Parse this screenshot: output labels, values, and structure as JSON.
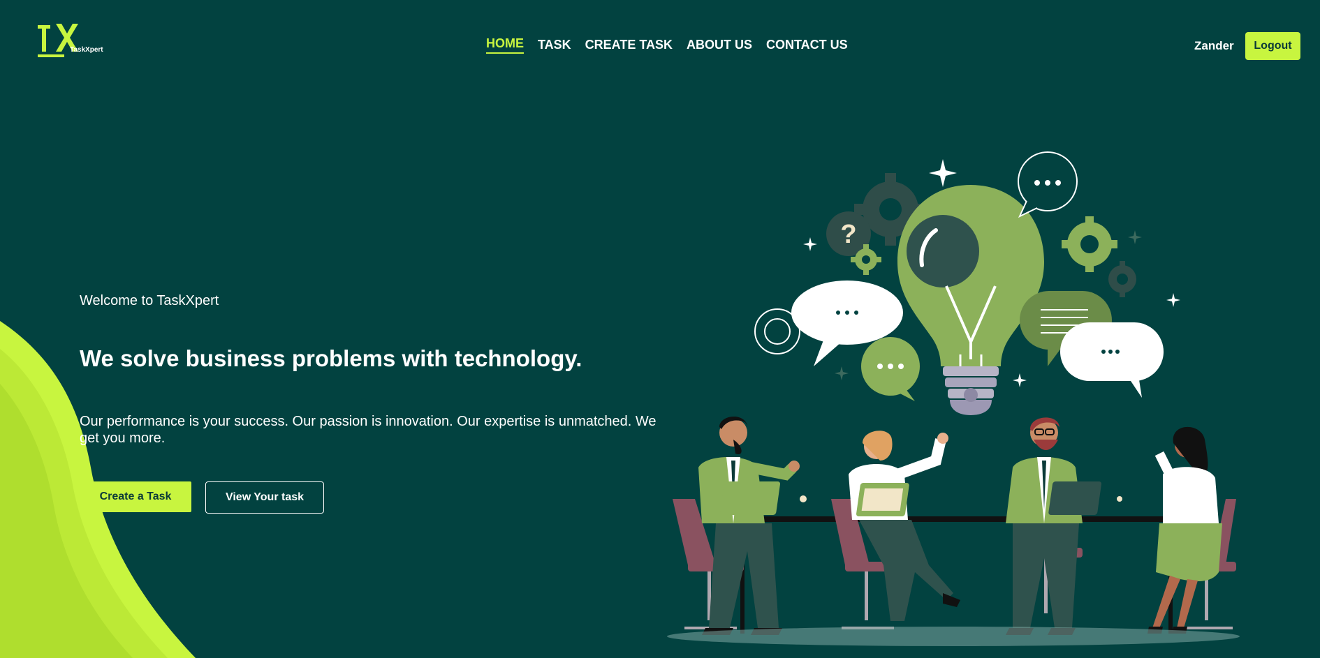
{
  "brand": {
    "logo_text": "TaskXpert",
    "colors": {
      "background": "#024240",
      "accent": "#c8f53f",
      "text": "#ffffff"
    }
  },
  "nav": {
    "items": [
      {
        "label": "HOME",
        "active": true
      },
      {
        "label": "TASK",
        "active": false
      },
      {
        "label": "CREATE TASK",
        "active": false
      },
      {
        "label": "ABOUT US",
        "active": false
      },
      {
        "label": "CONTACT US",
        "active": false
      }
    ]
  },
  "user": {
    "name": "Zander",
    "logout_label": "Logout"
  },
  "hero": {
    "welcome": "Welcome to TaskXpert",
    "headline": "We solve business problems with technology.",
    "tagline": "Our performance is your success. Our passion is innovation. Our expertise is unmatched. We get you more.",
    "primary_button": "Create a Task",
    "secondary_button": "View Your task"
  },
  "illustration": {
    "question_mark": "?",
    "bubble_dots": "..."
  }
}
